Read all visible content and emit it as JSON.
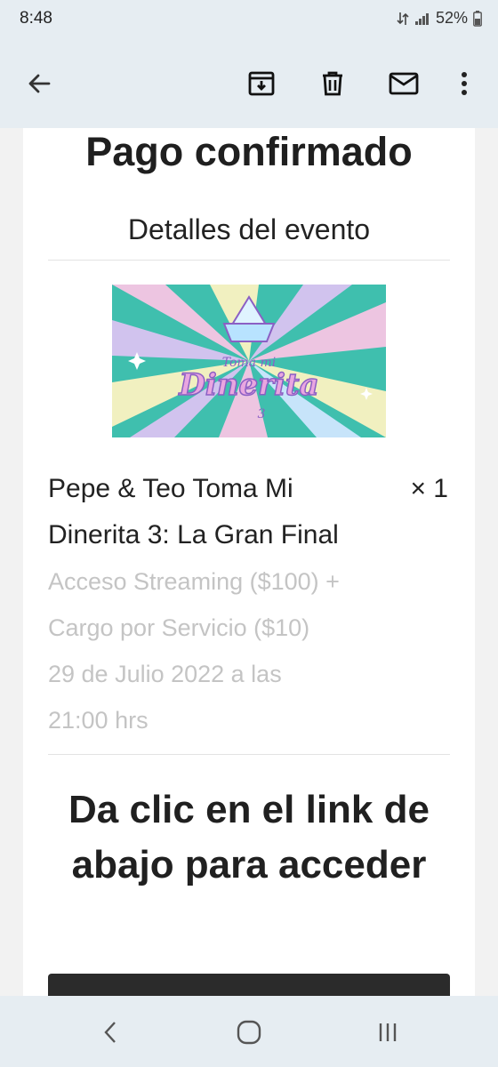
{
  "status_bar": {
    "time": "8:48",
    "battery": "52%",
    "icons": [
      "data-transfer-icon",
      "signal-icon",
      "battery-icon"
    ]
  },
  "toolbar": {
    "icons": [
      "back-arrow-icon",
      "archive-icon",
      "delete-icon",
      "mark-unread-icon",
      "more-options-icon"
    ]
  },
  "email": {
    "headline": "Pago confirmado",
    "section_title": "Detalles del evento",
    "banner_logo_text": [
      "Toma mi",
      "Dinerita",
      "3"
    ],
    "item": {
      "name": "Pepe & Teo Toma Mi Dinerita 3: La Gran Final",
      "quantity": "× 1",
      "details": [
        "Acceso Streaming ($100) +",
        "Cargo por Servicio ($10)",
        "29 de Julio 2022 a las",
        "21:00 hrs"
      ]
    },
    "cta_heading": "Da clic en el link de abajo para acceder"
  },
  "nav_bar": {
    "icons": [
      "back-icon",
      "home-icon",
      "recents-icon"
    ]
  },
  "colors": {
    "app_bar": "#e6edf2",
    "text": "#1f1f1f",
    "muted_text": "#c4c4c4",
    "button": "#2b2b2b",
    "banner_teal": "#3fbfae",
    "banner_pink": "#f7c6e4",
    "banner_purple": "#8b5fc4"
  }
}
